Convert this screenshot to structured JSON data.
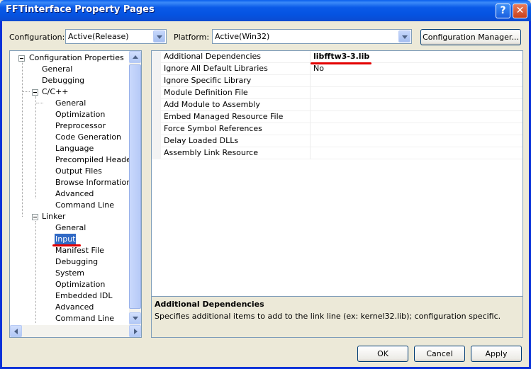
{
  "window": {
    "title": "FFTinterface Property Pages",
    "help_glyph": "?",
    "close_glyph": "✕"
  },
  "config_bar": {
    "configuration_label": "Configuration:",
    "configuration_value": "Active(Release)",
    "platform_label": "Platform:",
    "platform_value": "Active(Win32)",
    "config_manager_label": "Configuration Manager..."
  },
  "tree": {
    "root": "Configuration Properties",
    "items": [
      {
        "label": "General"
      },
      {
        "label": "Debugging"
      },
      {
        "label": "C/C++"
      },
      {
        "label": "General"
      },
      {
        "label": "Optimization"
      },
      {
        "label": "Preprocessor"
      },
      {
        "label": "Code Generation"
      },
      {
        "label": "Language"
      },
      {
        "label": "Precompiled Headers"
      },
      {
        "label": "Output Files"
      },
      {
        "label": "Browse Information"
      },
      {
        "label": "Advanced"
      },
      {
        "label": "Command Line"
      },
      {
        "label": "Linker"
      },
      {
        "label": "General"
      },
      {
        "label": "Input"
      },
      {
        "label": "Manifest File"
      },
      {
        "label": "Debugging"
      },
      {
        "label": "System"
      },
      {
        "label": "Optimization"
      },
      {
        "label": "Embedded IDL"
      },
      {
        "label": "Advanced"
      },
      {
        "label": "Command Line"
      }
    ],
    "selected": "Input"
  },
  "properties": [
    {
      "name": "Additional Dependencies",
      "value": "libfftw3-3.lib"
    },
    {
      "name": "Ignore All Default Libraries",
      "value": "No"
    },
    {
      "name": "Ignore Specific Library",
      "value": ""
    },
    {
      "name": "Module Definition File",
      "value": ""
    },
    {
      "name": "Add Module to Assembly",
      "value": ""
    },
    {
      "name": "Embed Managed Resource File",
      "value": ""
    },
    {
      "name": "Force Symbol References",
      "value": ""
    },
    {
      "name": "Delay Loaded DLLs",
      "value": ""
    },
    {
      "name": "Assembly Link Resource",
      "value": ""
    }
  ],
  "description": {
    "title": "Additional Dependencies",
    "text": "Specifies additional items to add to the link line (ex: kernel32.lib); configuration specific."
  },
  "buttons": {
    "ok": "OK",
    "cancel": "Cancel",
    "apply": "Apply"
  },
  "colors": {
    "selection": "#316AC5",
    "annotation_underline": "#E30000",
    "titlebar": "#0553E1"
  }
}
